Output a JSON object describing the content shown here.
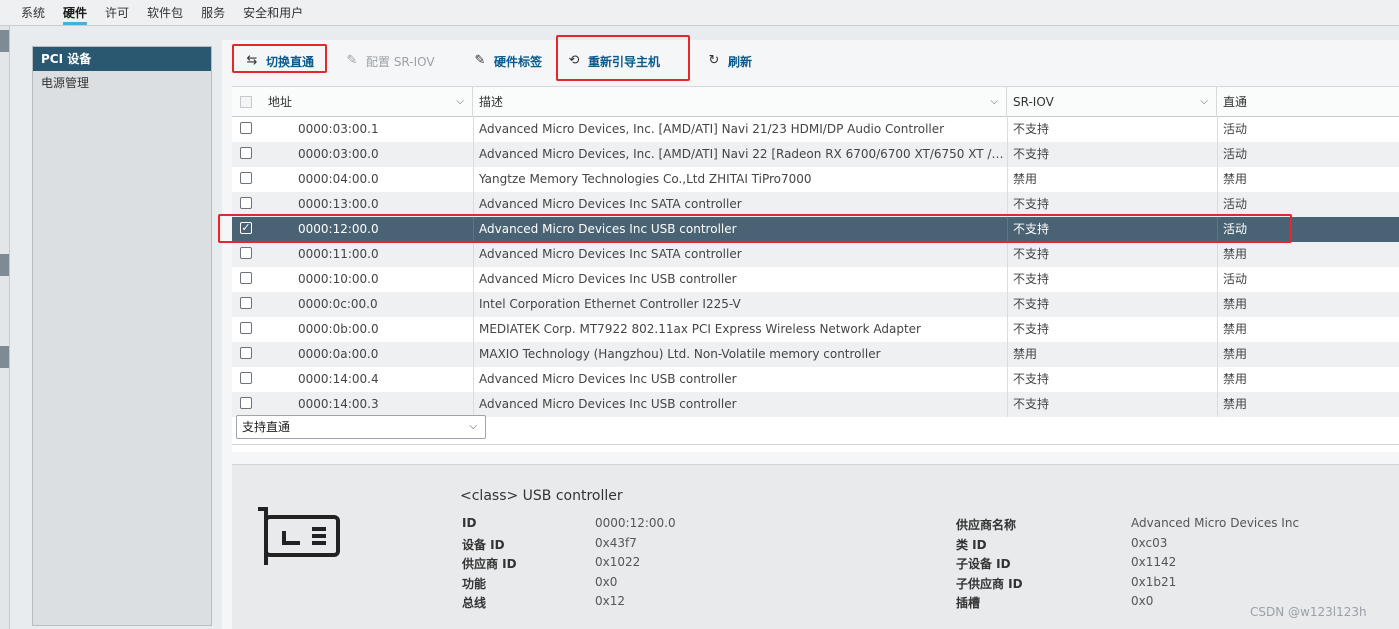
{
  "top_tabs": [
    "系统",
    "硬件",
    "许可",
    "软件包",
    "服务",
    "安全和用户"
  ],
  "sidebar": {
    "items": [
      {
        "label": "PCI 设备"
      },
      {
        "label": "电源管理"
      }
    ]
  },
  "toolbar": {
    "toggle_passthrough": "切换直通",
    "configure_sriov": "配置 SR-IOV",
    "hardware_label": "硬件标签",
    "reboot_host": "重新引导主机",
    "refresh": "刷新"
  },
  "table": {
    "columns": [
      "地址",
      "描述",
      "SR-IOV",
      "直通"
    ],
    "rows": [
      {
        "address": "0000:03:00.1",
        "description": "Advanced Micro Devices, Inc. [AMD/ATI] Navi 21/23 HDMI/DP Audio Controller",
        "sriov": "不支持",
        "passthrough": "活动"
      },
      {
        "address": "0000:03:00.0",
        "description": "Advanced Micro Devices, Inc. [AMD/ATI] Navi 22 [Radeon RX 6700/6700 XT/6750 XT / ...",
        "sriov": "不支持",
        "passthrough": "活动"
      },
      {
        "address": "0000:04:00.0",
        "description": "Yangtze Memory Technologies Co.,Ltd ZHITAI TiPro7000",
        "sriov": "禁用",
        "passthrough": "禁用"
      },
      {
        "address": "0000:13:00.0",
        "description": "Advanced Micro Devices Inc SATA controller",
        "sriov": "不支持",
        "passthrough": "活动"
      },
      {
        "address": "0000:12:00.0",
        "description": "Advanced Micro Devices Inc USB controller",
        "sriov": "不支持",
        "passthrough": "活动"
      },
      {
        "address": "0000:11:00.0",
        "description": "Advanced Micro Devices Inc SATA controller",
        "sriov": "不支持",
        "passthrough": "禁用"
      },
      {
        "address": "0000:10:00.0",
        "description": "Advanced Micro Devices Inc USB controller",
        "sriov": "不支持",
        "passthrough": "活动"
      },
      {
        "address": "0000:0c:00.0",
        "description": "Intel Corporation Ethernet Controller I225-V",
        "sriov": "不支持",
        "passthrough": "禁用"
      },
      {
        "address": "0000:0b:00.0",
        "description": "MEDIATEK Corp. MT7922 802.11ax PCI Express Wireless Network Adapter",
        "sriov": "不支持",
        "passthrough": "禁用"
      },
      {
        "address": "0000:0a:00.0",
        "description": "MAXIO Technology (Hangzhou) Ltd. Non-Volatile memory controller",
        "sriov": "禁用",
        "passthrough": "禁用"
      },
      {
        "address": "0000:14:00.4",
        "description": "Advanced Micro Devices Inc USB controller",
        "sriov": "不支持",
        "passthrough": "禁用"
      },
      {
        "address": "0000:14:00.3",
        "description": "Advanced Micro Devices Inc USB controller",
        "sriov": "不支持",
        "passthrough": "禁用"
      }
    ],
    "selected_index": 4
  },
  "filter": {
    "value": "支持直通"
  },
  "details": {
    "title": "<class> USB controller",
    "left": [
      {
        "label": "ID",
        "value": "0000:12:00.0"
      },
      {
        "label": "设备 ID",
        "value": "0x43f7"
      },
      {
        "label": "供应商 ID",
        "value": "0x1022"
      },
      {
        "label": "功能",
        "value": "0x0"
      },
      {
        "label": "总线",
        "value": "0x12"
      }
    ],
    "right": [
      {
        "label": "供应商名称",
        "value": "Advanced Micro Devices Inc"
      },
      {
        "label": "类 ID",
        "value": "0xc03"
      },
      {
        "label": "子设备 ID",
        "value": "0x1142"
      },
      {
        "label": "子供应商 ID",
        "value": "0x1b21"
      },
      {
        "label": "插槽",
        "value": "0x0"
      }
    ]
  },
  "watermark": "CSDN @w123l123h",
  "colors": {
    "accent": "#0b5a8c",
    "selected_row": "#4a6374",
    "highlight_box": "#e5262a",
    "sidebar_active": "#2a5871"
  }
}
